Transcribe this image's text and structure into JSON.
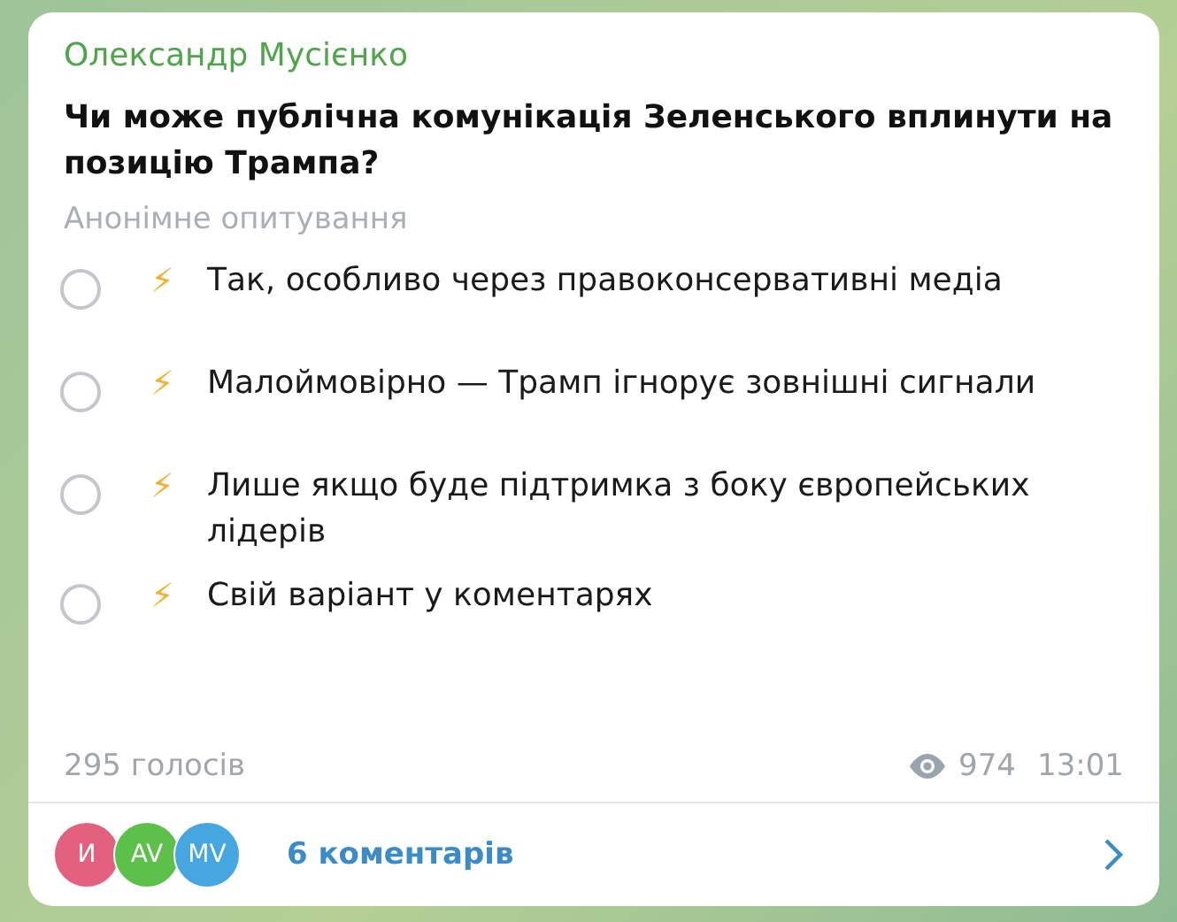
{
  "author": "Олександр Мусієнко",
  "question": "Чи може публічна комунікація Зеленського вплинути на позицію Трампа?",
  "poll_type": "Анонімне опитування",
  "options": [
    {
      "icon": "⚡",
      "text": "Так, особливо через правоконсервативні медіа",
      "selected": false
    },
    {
      "icon": "⚡",
      "text": "Малоймовірно — Трамп ігнорує зовнішні сигнали",
      "selected": false
    },
    {
      "icon": "⚡",
      "text": "Лише якщо буде підтримка з боку європейських лідерів",
      "selected": false
    },
    {
      "icon": "⚡",
      "text": "Свій варіант у коментарях",
      "selected": false
    }
  ],
  "votes": "295 голосів",
  "views": "974",
  "time": "13:01",
  "commenters": [
    {
      "initials": "И",
      "color": "#e3607e"
    },
    {
      "initials": "AV",
      "color": "#5cc04a"
    },
    {
      "initials": "MV",
      "color": "#45a6e0"
    }
  ],
  "comments": "6 коментарів"
}
